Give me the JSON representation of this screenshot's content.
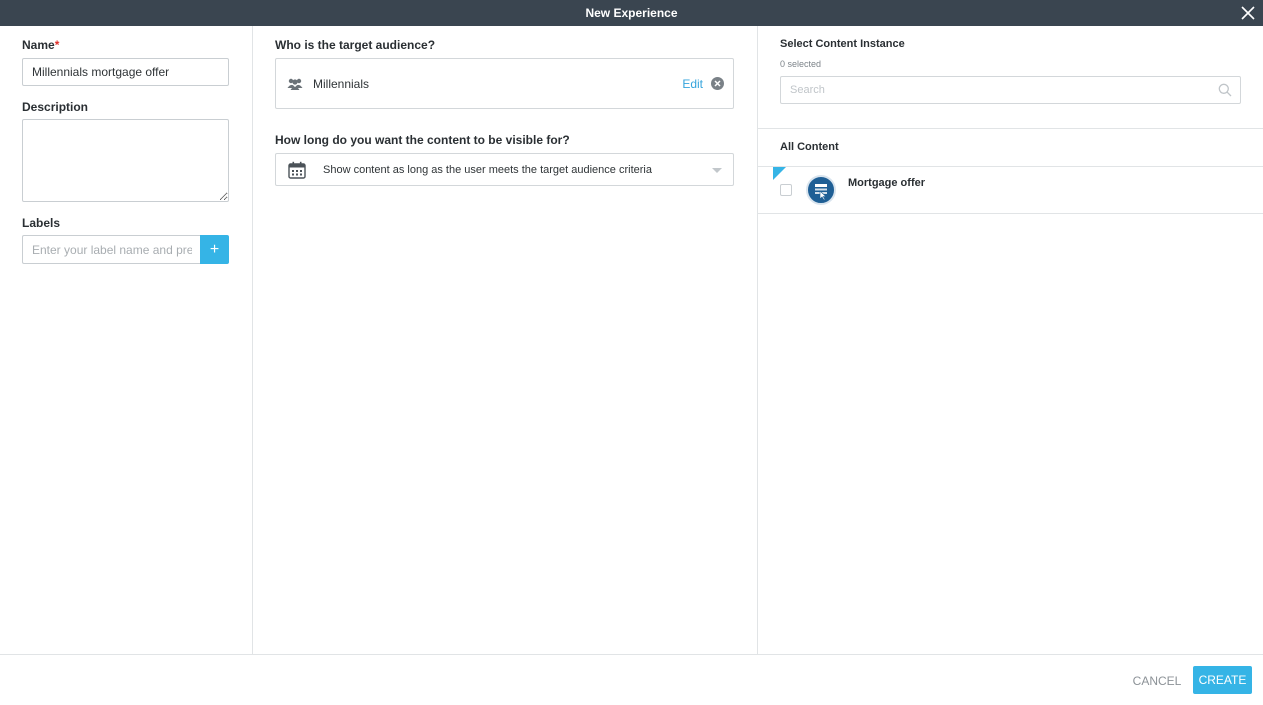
{
  "window": {
    "title": "New Experience"
  },
  "colors": {
    "accent": "#35b4e6",
    "titlebar": "#3a4550",
    "required": "#e0302a",
    "link": "#35a4dc"
  },
  "left": {
    "name_label": "Name",
    "required_mark": "*",
    "name_value": "Millennials mortgage offer",
    "description_label": "Description",
    "labels_label": "Labels",
    "labels_placeholder": "Enter your label name and press enter",
    "add_icon": "+"
  },
  "middle": {
    "audience_question": "Who is the target audience?",
    "audience": {
      "icon": "users-icon",
      "name": "Millennials",
      "edit_label": "Edit",
      "remove_icon": "remove-circle-icon"
    },
    "visibility_question": "How long do you want the content to be visible for?",
    "visibility": {
      "icon": "calendar-icon",
      "selected": "Show content as long as the user meets the target audience criteria"
    }
  },
  "right": {
    "title": "Select Content Instance",
    "selected_count": "0 selected",
    "search_placeholder": "Search",
    "section_title": "All Content",
    "items": [
      {
        "name": "Mortgage offer",
        "icon": "content-card-icon",
        "checked": false
      }
    ]
  },
  "footer": {
    "cancel_label": "CANCEL",
    "create_label": "CREATE"
  }
}
